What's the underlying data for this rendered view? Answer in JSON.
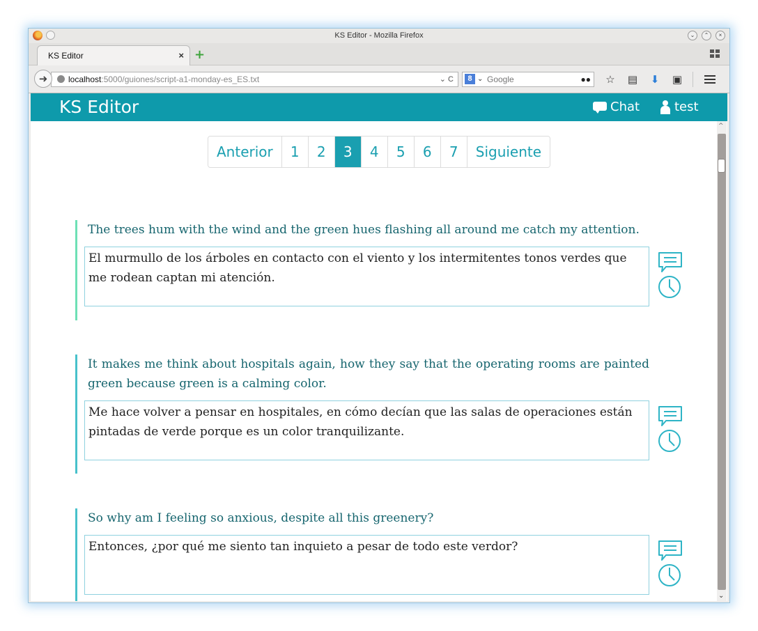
{
  "window": {
    "title": "KS Editor - Mozilla Firefox"
  },
  "tabs": [
    {
      "label": "KS Editor",
      "close": "×"
    }
  ],
  "newtab": "+",
  "url": {
    "host": "localhost",
    "path": ":5000/guiones/script-a1-monday-es_ES.txt"
  },
  "search": {
    "placeholder": "Google",
    "engine_icon": "8"
  },
  "app": {
    "brand": "KS Editor",
    "chat_label": "Chat",
    "user_label": "test",
    "accent": "#0e9aab"
  },
  "pagination": {
    "prev": "Anterior",
    "pages": [
      "1",
      "2",
      "3",
      "4",
      "5",
      "6",
      "7"
    ],
    "active": "3",
    "next": "Siguiente"
  },
  "segments": [
    {
      "source": "The trees hum with the wind and the green hues flashing all around me catch my attention.",
      "target": "El murmullo de los árboles en contacto con el viento y los intermitentes tonos verdes que me rodean captan mi atención.",
      "bar_color": "#6ee0b5"
    },
    {
      "source": "It makes me think about hospitals again, how they say that the operating rooms are painted green because green is a calming color.",
      "target": "Me hace volver a pensar en hospitales, en cómo decían que las salas de operaciones están pintadas de verde porque es un color tranquilizante.",
      "bar_color": "#48c1cb"
    },
    {
      "source": "So why am I feeling so anxious, despite all this greenery?",
      "target": "Entonces, ¿por qué me siento tan inquieto a pesar de todo este verdor?",
      "bar_color": "#48c1cb"
    }
  ]
}
